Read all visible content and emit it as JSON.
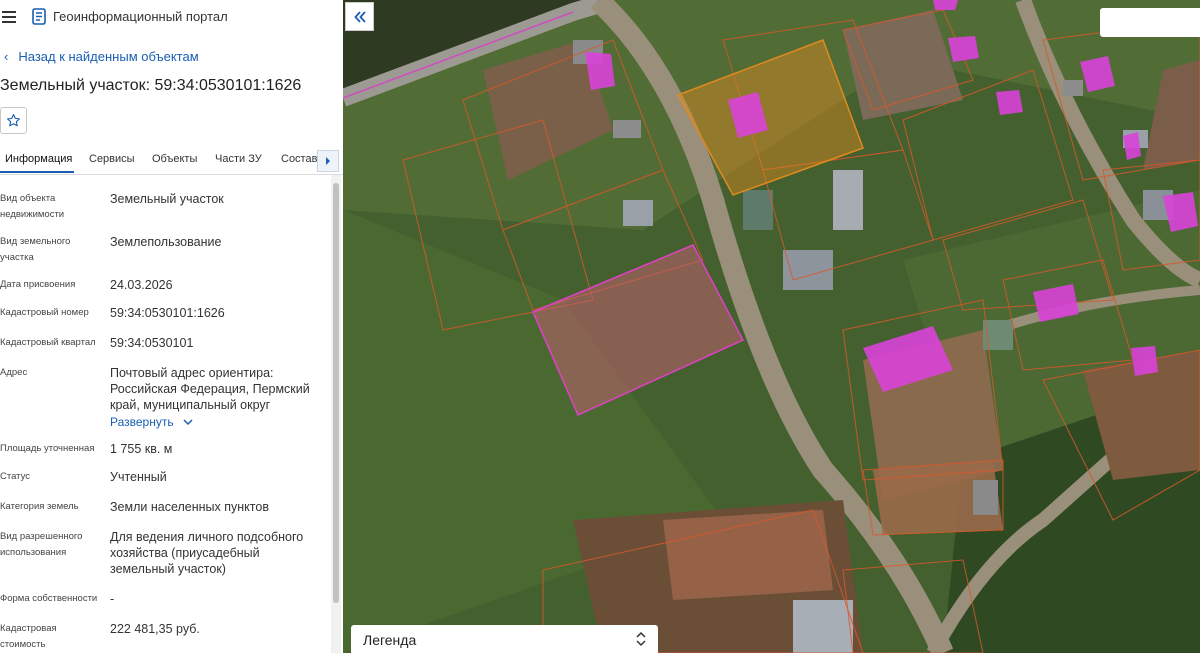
{
  "app": {
    "title": "Геоинформационный портал"
  },
  "nav": {
    "back_label": "Назад к найденным объектам"
  },
  "object": {
    "title": "Земельный участок: 59:34:0530101:1626"
  },
  "tabs": [
    {
      "label": "Информация",
      "active": true
    },
    {
      "label": "Сервисы"
    },
    {
      "label": "Объекты"
    },
    {
      "label": "Части ЗУ"
    },
    {
      "label": "Состав"
    }
  ],
  "properties": [
    {
      "label": "Вид объекта недвижимости",
      "value": "Земельный участок"
    },
    {
      "label": "Вид земельного участка",
      "value": "Землепользование"
    },
    {
      "label": "Дата присвоения",
      "value": "24.03.2026"
    },
    {
      "label": "Кадастровый номер",
      "value": "59:34:0530101:1626"
    },
    {
      "label": "Кадастровый квартал",
      "value": "59:34:0530101"
    },
    {
      "label": "Адрес",
      "value": "Почтовый адрес ориентира: Российская Федерация, Пермский край, муниципальный округ",
      "expand_label": "Развернуть"
    },
    {
      "label": "Площадь уточненная",
      "value": "1 755 кв. м"
    },
    {
      "label": "Статус",
      "value": "Учтенный"
    },
    {
      "label": "Категория земель",
      "value": "Земли населенных пунктов"
    },
    {
      "label": "Вид разрешенного использования",
      "value": "Для ведения личного подсобного хозяйства (приусадебный земельный участок)"
    },
    {
      "label": "Форма собственности",
      "value": "-"
    },
    {
      "label": "Кадастровая стоимость",
      "value": "222 481,35 руб."
    }
  ],
  "map": {
    "search_value": ""
  },
  "legend": {
    "title": "Легенда"
  },
  "colors": {
    "accent": "#1a5fb4",
    "selected_parcel": "#e040c8",
    "highlighted_parcel": "#e08a1e",
    "parcel_border": "#d9582a"
  }
}
